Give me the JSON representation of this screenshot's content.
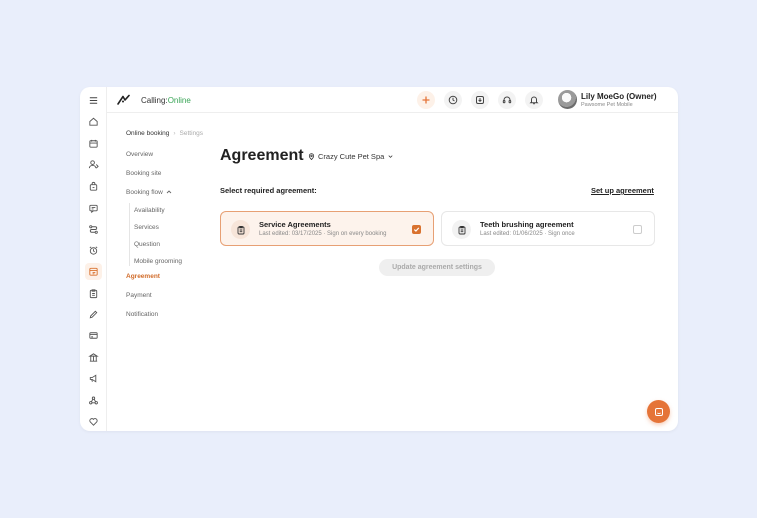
{
  "topbar": {
    "calling_label": "Calling:",
    "calling_status": "Online",
    "user_name": "Lily MoeGo (Owner)",
    "user_subtitle": "Pawsome Pet Mobile"
  },
  "breadcrumb": {
    "parent": "Online booking",
    "current": "Settings"
  },
  "settings_nav": {
    "overview": "Overview",
    "booking_site": "Booking site",
    "booking_flow": "Booking flow",
    "sub_items": [
      "Availability",
      "Services",
      "Question",
      "Mobile grooming"
    ],
    "agreement": "Agreement",
    "payment": "Payment",
    "notification": "Notification"
  },
  "main": {
    "title": "Agreement",
    "location": "Crazy Cute Pet Spa",
    "select_label": "Select required agreement:",
    "setup_link": "Set up agreement",
    "update_button": "Update agreement settings"
  },
  "agreements": [
    {
      "title": "Service Agreements",
      "subtitle": "Last edited: 03/17/2025 · Sign on every booking",
      "checked": true
    },
    {
      "title": "Teeth brushing agreement",
      "subtitle": "Last edited: 01/06/2025 · Sign once",
      "checked": false
    }
  ],
  "colors": {
    "accent": "#e57438",
    "online": "#3aa557",
    "background": "#e9eefb"
  }
}
